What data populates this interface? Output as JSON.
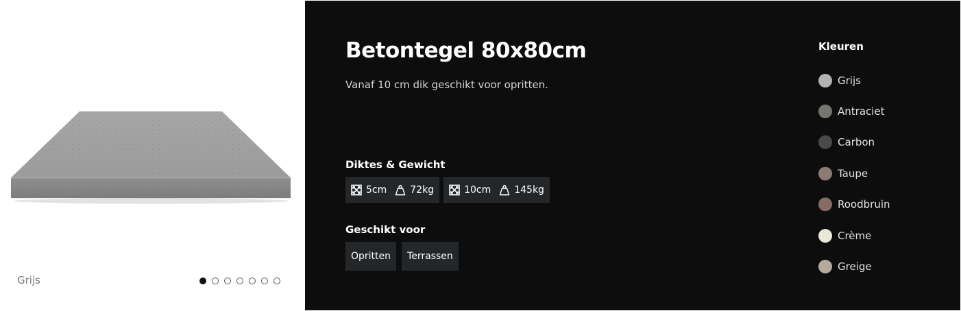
{
  "gallery": {
    "caption": "Grijs",
    "dots": [
      {
        "active": true
      },
      {
        "active": false
      },
      {
        "active": false
      },
      {
        "active": false
      },
      {
        "active": false
      },
      {
        "active": false
      },
      {
        "active": false
      }
    ]
  },
  "product": {
    "title": "Betontegel 80x80cm",
    "subtitle": "Vanaf 10 cm dik geschikt voor opritten."
  },
  "specs": {
    "label": "Diktes & Gewicht",
    "items": [
      {
        "thickness": "5cm",
        "weight": "72kg"
      },
      {
        "thickness": "10cm",
        "weight": "145kg"
      }
    ]
  },
  "suitable": {
    "label": "Geschikt voor",
    "items": [
      "Opritten",
      "Terrassen"
    ]
  },
  "colors": {
    "label": "Kleuren",
    "items": [
      {
        "name": "Grijs",
        "hex": "#b3b3b3"
      },
      {
        "name": "Antraciet",
        "hex": "#77756f"
      },
      {
        "name": "Carbon",
        "hex": "#4a4a49"
      },
      {
        "name": "Taupe",
        "hex": "#8c7a74"
      },
      {
        "name": "Roodbruin",
        "hex": "#876c66"
      },
      {
        "name": "Crème",
        "hex": "#ece8d8"
      },
      {
        "name": "Greige",
        "hex": "#b5a99a"
      }
    ]
  },
  "theme": {
    "panel_bg": "#0d0d0d",
    "chip_bg": "#24272a",
    "tile_gray": "#a9a9a9"
  }
}
